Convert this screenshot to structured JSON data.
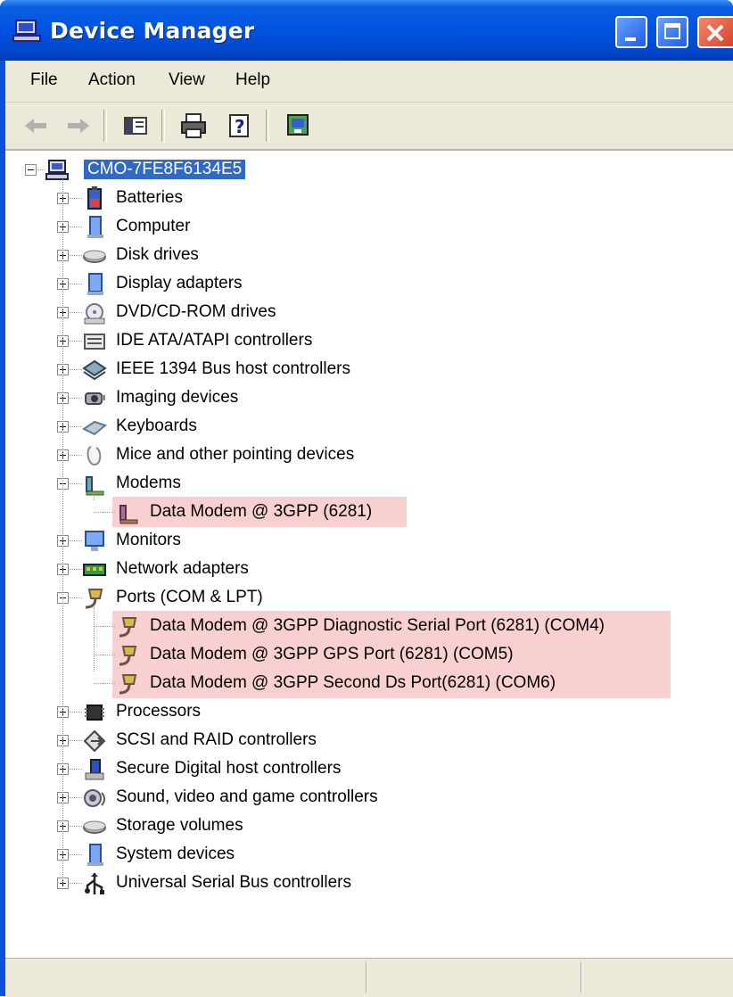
{
  "window": {
    "title": "Device Manager",
    "buttons": [
      "minimize",
      "maximize",
      "close"
    ]
  },
  "menubar": {
    "items": [
      "File",
      "Action",
      "View",
      "Help"
    ]
  },
  "toolbar": {
    "icons": [
      "back-arrow-icon",
      "forward-arrow-icon",
      "show-hide-console-tree-icon",
      "print-icon",
      "help-icon",
      "properties-icon"
    ]
  },
  "tree": {
    "root": "CMO-7FE8F6134E5",
    "categories": [
      {
        "label": "Batteries",
        "icon": "battery-icon",
        "expanded": false
      },
      {
        "label": "Computer",
        "icon": "computer-icon",
        "expanded": false
      },
      {
        "label": "Disk drives",
        "icon": "disk-drive-icon",
        "expanded": false
      },
      {
        "label": "Display adapters",
        "icon": "display-adapter-icon",
        "expanded": false
      },
      {
        "label": "DVD/CD-ROM drives",
        "icon": "dvd-drive-icon",
        "expanded": false
      },
      {
        "label": "IDE ATA/ATAPI controllers",
        "icon": "ide-controller-icon",
        "expanded": false
      },
      {
        "label": "IEEE 1394 Bus host controllers",
        "icon": "ieee1394-icon",
        "expanded": false
      },
      {
        "label": "Imaging devices",
        "icon": "camera-icon",
        "expanded": false
      },
      {
        "label": "Keyboards",
        "icon": "keyboard-icon",
        "expanded": false
      },
      {
        "label": "Mice and other pointing devices",
        "icon": "mouse-icon",
        "expanded": false
      },
      {
        "label": "Modems",
        "icon": "modem-icon",
        "expanded": true,
        "children": [
          "Data Modem @ 3GPP (6281)"
        ]
      },
      {
        "label": "Monitors",
        "icon": "monitor-icon",
        "expanded": false
      },
      {
        "label": "Network adapters",
        "icon": "network-adapter-icon",
        "expanded": false
      },
      {
        "label": "Ports (COM & LPT)",
        "icon": "port-icon",
        "expanded": true,
        "children": [
          "Data Modem @ 3GPP Diagnostic Serial Port (6281) (COM4)",
          "Data Modem @ 3GPP GPS Port (6281) (COM5)",
          "Data Modem @ 3GPP Second Ds Port(6281) (COM6)"
        ]
      },
      {
        "label": "Processors",
        "icon": "processor-icon",
        "expanded": false
      },
      {
        "label": "SCSI and RAID controllers",
        "icon": "scsi-icon",
        "expanded": false
      },
      {
        "label": "Secure Digital host controllers",
        "icon": "sd-controller-icon",
        "expanded": false
      },
      {
        "label": "Sound, video and game controllers",
        "icon": "sound-icon",
        "expanded": false
      },
      {
        "label": "Storage volumes",
        "icon": "storage-volume-icon",
        "expanded": false
      },
      {
        "label": "System devices",
        "icon": "system-device-icon",
        "expanded": false
      },
      {
        "label": "Universal Serial Bus controllers",
        "icon": "usb-icon",
        "expanded": false
      }
    ]
  },
  "colors": {
    "titlebar": "#0054e3",
    "selection": "#316ac5",
    "highlight": "#f9d0d0",
    "chrome": "#ece9d8"
  }
}
